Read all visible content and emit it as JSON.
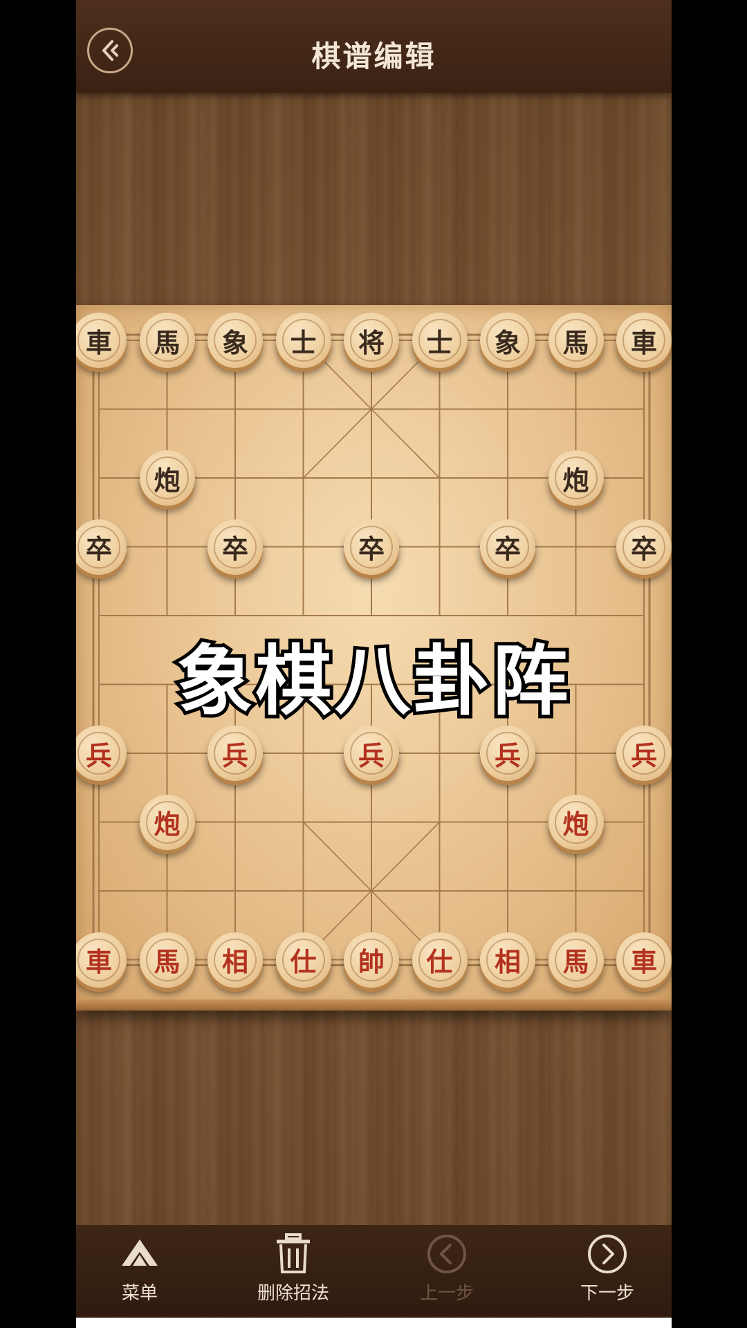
{
  "header": {
    "title": "棋谱编辑",
    "back_icon": "back-arrow-icon"
  },
  "overlay": {
    "caption": "象棋八卦阵"
  },
  "board": {
    "files": 9,
    "ranks": 10,
    "black_pieces": [
      {
        "char": "車",
        "col": 0,
        "row": 0
      },
      {
        "char": "馬",
        "col": 1,
        "row": 0
      },
      {
        "char": "象",
        "col": 2,
        "row": 0
      },
      {
        "char": "士",
        "col": 3,
        "row": 0
      },
      {
        "char": "将",
        "col": 4,
        "row": 0
      },
      {
        "char": "士",
        "col": 5,
        "row": 0
      },
      {
        "char": "象",
        "col": 6,
        "row": 0
      },
      {
        "char": "馬",
        "col": 7,
        "row": 0
      },
      {
        "char": "車",
        "col": 8,
        "row": 0
      },
      {
        "char": "炮",
        "col": 1,
        "row": 2
      },
      {
        "char": "炮",
        "col": 7,
        "row": 2
      },
      {
        "char": "卒",
        "col": 0,
        "row": 3
      },
      {
        "char": "卒",
        "col": 2,
        "row": 3
      },
      {
        "char": "卒",
        "col": 4,
        "row": 3
      },
      {
        "char": "卒",
        "col": 6,
        "row": 3
      },
      {
        "char": "卒",
        "col": 8,
        "row": 3
      }
    ],
    "red_pieces": [
      {
        "char": "兵",
        "col": 0,
        "row": 6
      },
      {
        "char": "兵",
        "col": 2,
        "row": 6
      },
      {
        "char": "兵",
        "col": 4,
        "row": 6
      },
      {
        "char": "兵",
        "col": 6,
        "row": 6
      },
      {
        "char": "兵",
        "col": 8,
        "row": 6
      },
      {
        "char": "炮",
        "col": 1,
        "row": 7
      },
      {
        "char": "炮",
        "col": 7,
        "row": 7
      },
      {
        "char": "車",
        "col": 0,
        "row": 9
      },
      {
        "char": "馬",
        "col": 1,
        "row": 9
      },
      {
        "char": "相",
        "col": 2,
        "row": 9
      },
      {
        "char": "仕",
        "col": 3,
        "row": 9
      },
      {
        "char": "帥",
        "col": 4,
        "row": 9
      },
      {
        "char": "仕",
        "col": 5,
        "row": 9
      },
      {
        "char": "相",
        "col": 6,
        "row": 9
      },
      {
        "char": "馬",
        "col": 7,
        "row": 9
      },
      {
        "char": "車",
        "col": 8,
        "row": 9
      }
    ],
    "colors": {
      "black_piece_text": "#3a2a1e",
      "red_piece_text": "#b3321e",
      "grid_line": "#a47a4c"
    }
  },
  "toolbar": {
    "menu_label": "菜单",
    "menu_icon": "menu-chevron-icon",
    "delete_label": "删除招法",
    "delete_icon": "trash-icon",
    "prev_label": "上一步",
    "prev_icon": "chevron-left-circle-icon",
    "prev_enabled": false,
    "next_label": "下一步",
    "next_icon": "chevron-right-circle-icon",
    "next_enabled": true
  }
}
